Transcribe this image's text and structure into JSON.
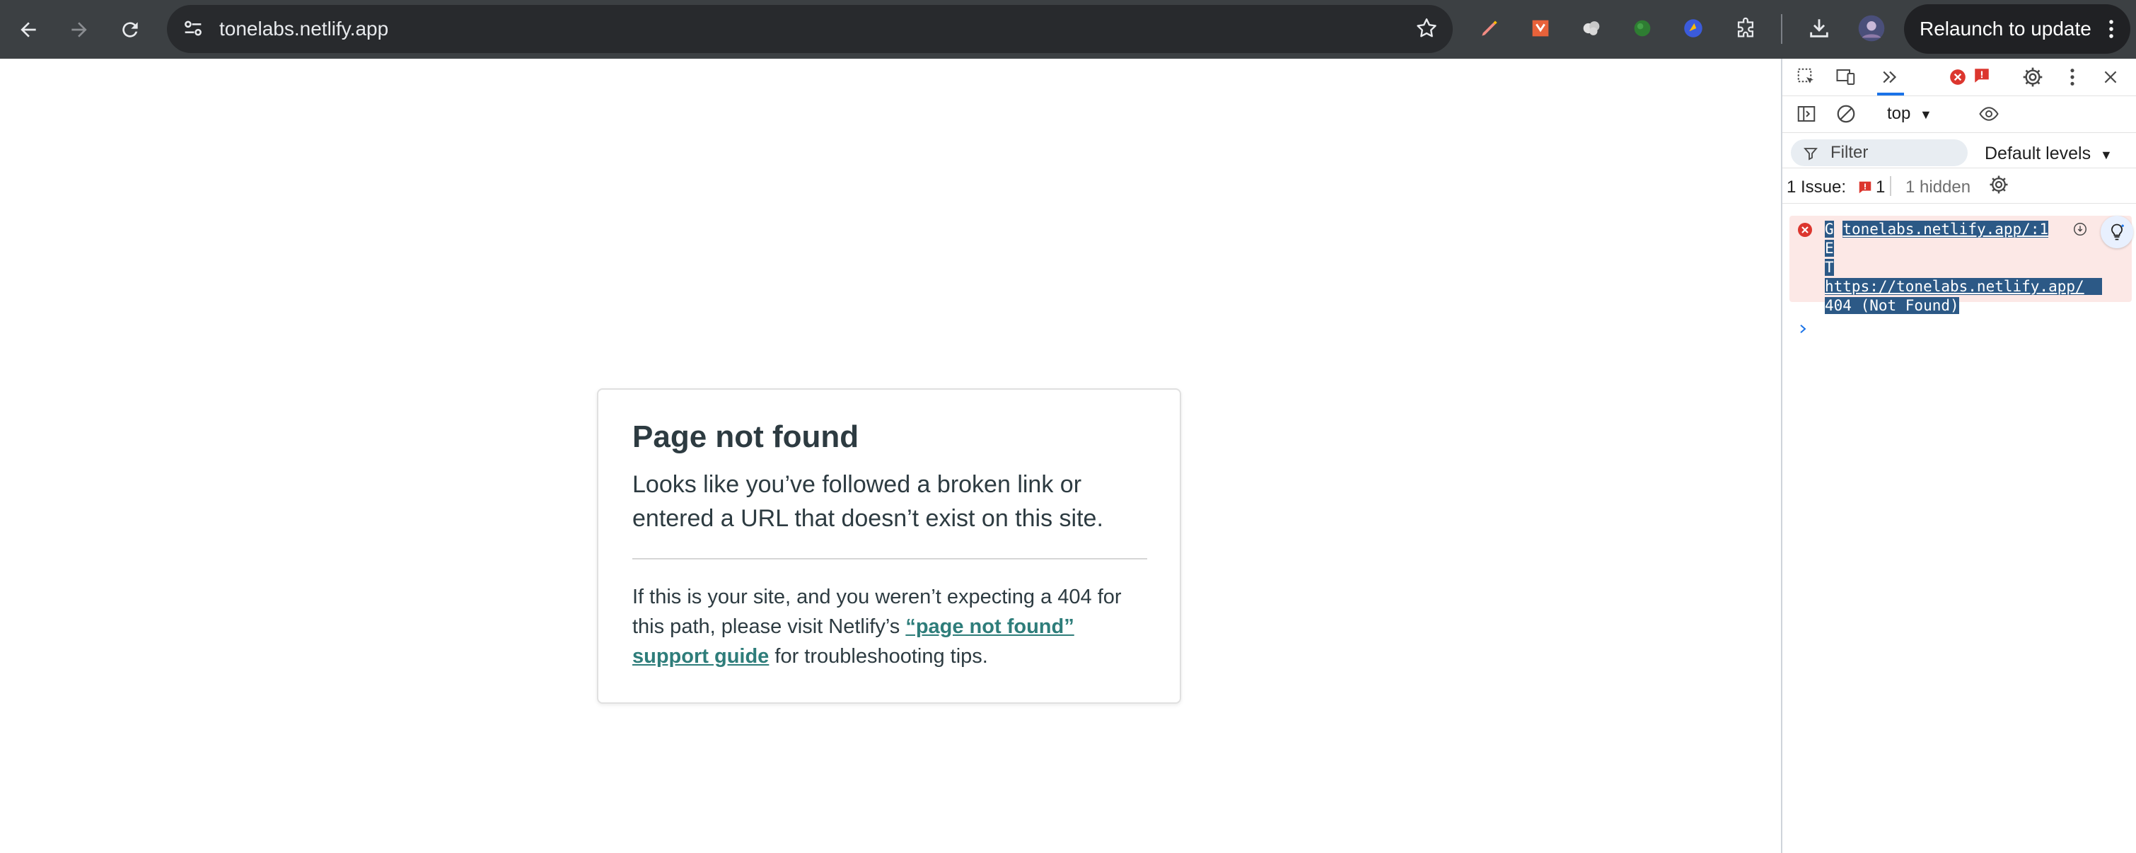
{
  "browser": {
    "url": "tonelabs.netlify.app",
    "relaunch_label": "Relaunch to update"
  },
  "page": {
    "title": "Page not found",
    "lead": "Looks like you’ve followed a broken link or entered a URL that doesn’t exist on this site.",
    "tip_before": "If this is your site, and you weren’t expecting a 404 for this path, please visit Netlify’s ",
    "tip_link": "“page not found” support guide",
    "tip_after": " for troubleshooting tips.",
    "link_color": "#2e7d7a"
  },
  "devtools": {
    "context": "top",
    "filter_placeholder": "Filter",
    "levels_label": "Default levels",
    "issues_label": "1 Issue:",
    "issues_count": "1",
    "hidden_label": "1 hidden",
    "error": {
      "line1_prefix": "G",
      "source": "tonelabs.netlify.app/:1",
      "line2": "E",
      "line3": "T",
      "url": "https://tonelabs.netlify.app/",
      "status": "404 (Not Found)"
    }
  },
  "icons": [
    "back-icon",
    "forward-icon",
    "reload-icon",
    "site-settings-icon",
    "bookmark-star-icon",
    "pen-extension-icon",
    "brave-extension-icon",
    "cloud-extension-icon",
    "green-extension-icon",
    "blue-extension-icon",
    "extensions-puzzle-icon",
    "download-icon",
    "profile-avatar",
    "more-vert-icon",
    "inspect-icon",
    "device-toolbar-icon",
    "more-tabs-icon",
    "error-count-icon",
    "issue-count-icon",
    "settings-gear-icon",
    "close-icon",
    "sidebar-toggle-icon",
    "clear-console-icon",
    "eye-icon",
    "filter-icon",
    "issue-flag-icon",
    "lightbulb-icon"
  ]
}
